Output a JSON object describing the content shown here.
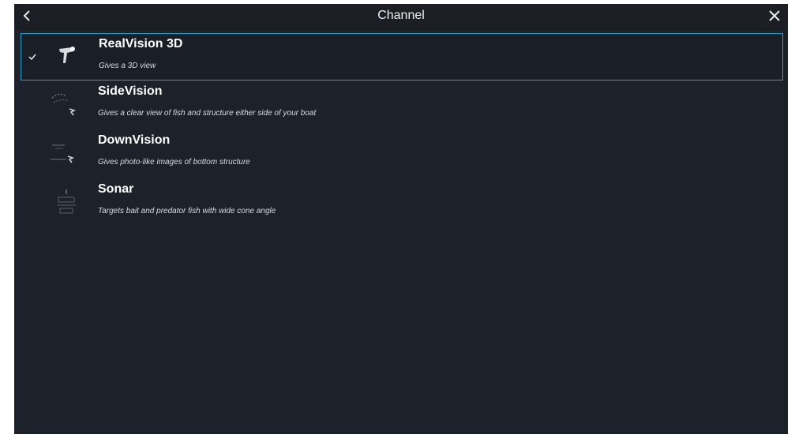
{
  "header": {
    "title": "Channel",
    "back_icon": "chevron-left-icon",
    "close_icon": "close-icon"
  },
  "colors": {
    "background": "#1d2129",
    "selection_border": "#2e9ac6",
    "text": "#ffffff"
  },
  "channels": [
    {
      "name": "RealVision 3D",
      "description": "Gives a 3D view",
      "selected": true,
      "icon": "realvision-3d-icon"
    },
    {
      "name": "SideVision",
      "description": "Gives a clear view of fish and structure either side of your boat",
      "selected": false,
      "icon": "sidevision-icon"
    },
    {
      "name": "DownVision",
      "description": "Gives photo-like images of bottom structure",
      "selected": false,
      "icon": "downvision-icon"
    },
    {
      "name": "Sonar",
      "description": "Targets bait and predator fish with wide cone angle",
      "selected": false,
      "icon": "sonar-icon"
    }
  ]
}
